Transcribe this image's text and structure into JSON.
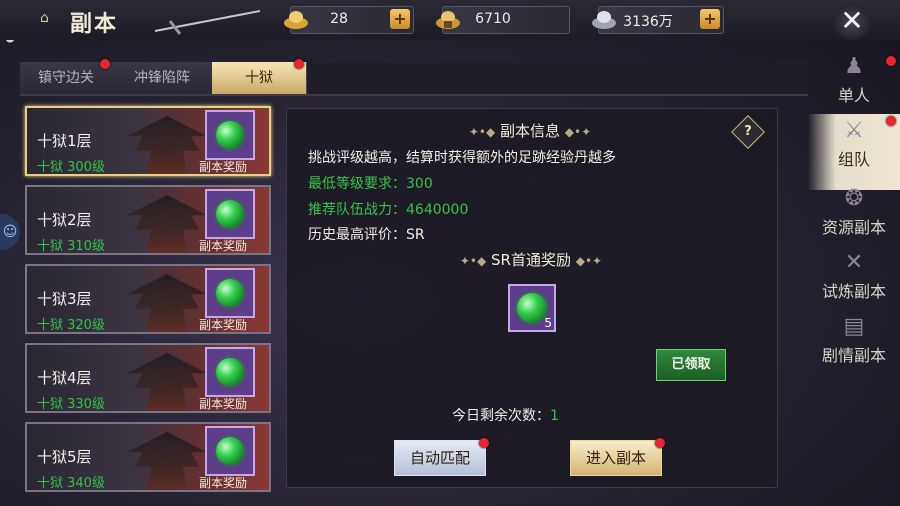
{
  "header": {
    "title": "副本",
    "resources": [
      {
        "icon": "gold-ingot-icon",
        "value": "28",
        "plus": "+"
      },
      {
        "icon": "bound-ingot-icon",
        "value": "6710",
        "plus": ""
      },
      {
        "icon": "silver-icon",
        "value": "3136万",
        "plus": "+"
      }
    ],
    "close_label": "✕"
  },
  "tabs": [
    {
      "label": "镇守边关",
      "badge": true
    },
    {
      "label": "冲锋陷阵",
      "badge": false
    },
    {
      "label": "十狱",
      "badge": true,
      "active": true
    }
  ],
  "floors": [
    {
      "name": "十狱1层",
      "level": "十狱 300级",
      "reward_label": "副本奖励",
      "selected": true
    },
    {
      "name": "十狱2层",
      "level": "十狱 310级",
      "reward_label": "副本奖励"
    },
    {
      "name": "十狱3层",
      "level": "十狱 320级",
      "reward_label": "副本奖励"
    },
    {
      "name": "十狱4层",
      "level": "十狱 330级",
      "reward_label": "副本奖励"
    },
    {
      "name": "十狱5层",
      "level": "十狱 340级",
      "reward_label": "副本奖励"
    }
  ],
  "info": {
    "section_title": "副本信息",
    "description": "挑战评级越高，结算时获得额外的足跡经验丹越多",
    "min_level": "最低等级要求：300",
    "recommended_power": "推荐队伍战力：4640000",
    "best_rating": "历史最高评价：SR",
    "reward_title": "SR首通奖励",
    "reward_count": "5",
    "claimed_label": "已领取",
    "remaining_label": "今日剩余次数：",
    "remaining_value": "1",
    "help_label": "?"
  },
  "buttons": {
    "auto_match": "自动匹配",
    "enter": "进入副本"
  },
  "side_nav": [
    {
      "label": "单人",
      "icon": "single-person-icon",
      "badge": true
    },
    {
      "label": "组队",
      "icon": "team-icon",
      "badge": true,
      "active": true
    },
    {
      "label": "资源副本",
      "icon": "resource-icon"
    },
    {
      "label": "试炼副本",
      "icon": "crossed-swords-icon"
    },
    {
      "label": "剧情副本",
      "icon": "book-icon"
    }
  ],
  "colors": {
    "level_green": "#35c24a",
    "badge_red": "#e8262e",
    "gold": "#e9cf86"
  }
}
